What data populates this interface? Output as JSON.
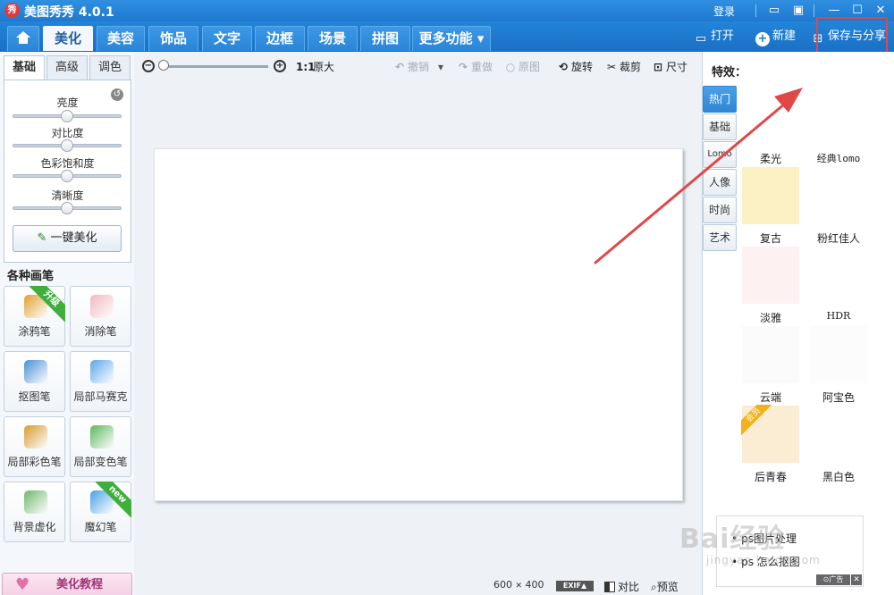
{
  "window": {
    "logo_glyph": "秀",
    "title": "美图秀秀 4.0.1",
    "login": "登录"
  },
  "tabs": [
    {
      "label": "美化",
      "active": true
    },
    {
      "label": "美容"
    },
    {
      "label": "饰品"
    },
    {
      "label": "文字"
    },
    {
      "label": "边框"
    },
    {
      "label": "场景"
    },
    {
      "label": "拼图"
    },
    {
      "label": "更多功能 ▾"
    }
  ],
  "top_actions": {
    "open": "打开",
    "new": "新建",
    "save_share": "保存与分享"
  },
  "adjust": {
    "tabs": [
      "基础",
      "高级",
      "调色"
    ],
    "sliders": [
      {
        "label": "亮度",
        "value": 0.5
      },
      {
        "label": "对比度",
        "value": 0.5
      },
      {
        "label": "色彩饱和度",
        "value": 0.5
      },
      {
        "label": "清晰度",
        "value": 0.5
      }
    ],
    "one_key": "一键美化"
  },
  "brushes": {
    "header": "各种画笔",
    "items": [
      {
        "label": "涂鸦笔",
        "badge": "升级",
        "color": "#e0a030"
      },
      {
        "label": "消除笔",
        "badge": "",
        "color": "#f0b8c0"
      },
      {
        "label": "抠图笔",
        "badge": "",
        "color": "#4a8fd6"
      },
      {
        "label": "局部马赛克",
        "badge": "",
        "color": "#5aa8e8"
      },
      {
        "label": "局部彩色笔",
        "badge": "",
        "color": "#d89a30"
      },
      {
        "label": "局部变色笔",
        "badge": "",
        "color": "#5cb85c"
      },
      {
        "label": "背景虚化",
        "badge": "",
        "color": "#6fb86f"
      },
      {
        "label": "魔幻笔",
        "badge": "new",
        "color": "#4aa0e8"
      }
    ]
  },
  "tutorial": "美化教程",
  "toolbar": {
    "zoom_ratio": "1:1",
    "original_size": "原大",
    "undo": "撤销",
    "redo": "重做",
    "original": "原图",
    "rotate": "旋转",
    "crop": "裁剪",
    "size": "尺寸"
  },
  "status": {
    "width": "600",
    "times": "✕",
    "height": "400",
    "exif": "EXIF▲",
    "compare": "对比",
    "preview": "预览"
  },
  "effects": {
    "title": "特效：",
    "categories": [
      {
        "label": "热门",
        "active": true
      },
      {
        "label": "基础"
      },
      {
        "label": "Lomo"
      },
      {
        "label": "人像"
      },
      {
        "label": "时尚"
      },
      {
        "label": "艺术"
      }
    ],
    "items": [
      {
        "label": "柔光",
        "color": "#ffffff"
      },
      {
        "label": "经典lomo",
        "color": "#ffffff"
      },
      {
        "label": "复古",
        "color": "#fbf1c4"
      },
      {
        "label": "粉红佳人",
        "color": "#ffffff"
      },
      {
        "label": "淡雅",
        "color": "#fdf1f1"
      },
      {
        "label": "HDR",
        "color": "#ffffff"
      },
      {
        "label": "云端",
        "color": "#fbfbfb"
      },
      {
        "label": "阿宝色",
        "color": "#fcfcfc"
      },
      {
        "label": "后青春",
        "color": "#fbecd4",
        "badge": "会员"
      },
      {
        "label": "黑白色",
        "color": "#ffffff"
      }
    ]
  },
  "ad": {
    "links": [
      "ps图片处理",
      "ps 怎么抠图"
    ],
    "tag": "⊙广告",
    "close": "✕"
  },
  "watermark": {
    "main": "Bai经验",
    "sub": "jingyan.baidu.com"
  },
  "colors": {
    "accent": "#1f79cf",
    "annotation": "#e04848"
  }
}
